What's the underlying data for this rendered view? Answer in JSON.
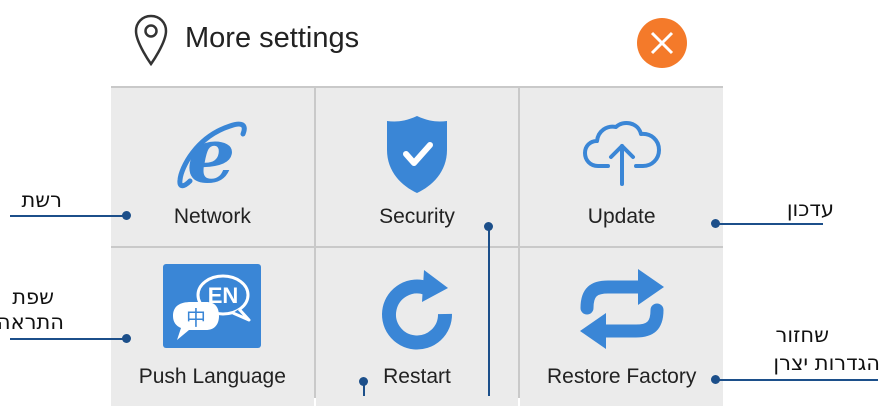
{
  "header": {
    "title": "More settings",
    "location_icon": "location-pin-icon",
    "close_icon": "close-icon"
  },
  "tiles": [
    {
      "label": "Network",
      "icon": "internet-explorer-icon"
    },
    {
      "label": "Security",
      "icon": "shield-check-icon"
    },
    {
      "label": "Update",
      "icon": "cloud-upload-icon"
    },
    {
      "label": "Push Language",
      "icon": "language-icon"
    },
    {
      "label": "Restart",
      "icon": "restart-icon"
    },
    {
      "label": "Restore Factory",
      "icon": "sync-icon"
    }
  ],
  "icon_text": {
    "lang_en": "EN",
    "lang_zh": "中"
  },
  "annotations": {
    "network": "רשת",
    "update": "עדכון",
    "alert_lang_1": "שפת",
    "alert_lang_2": "התראה",
    "restore_1": "שחזור",
    "restore_2": "הגדרות יצרן"
  },
  "colors": {
    "accent": "#3a86d6",
    "close": "#f47a2a",
    "callout": "#1c4f8a",
    "tile_bg": "#ebebeb"
  }
}
